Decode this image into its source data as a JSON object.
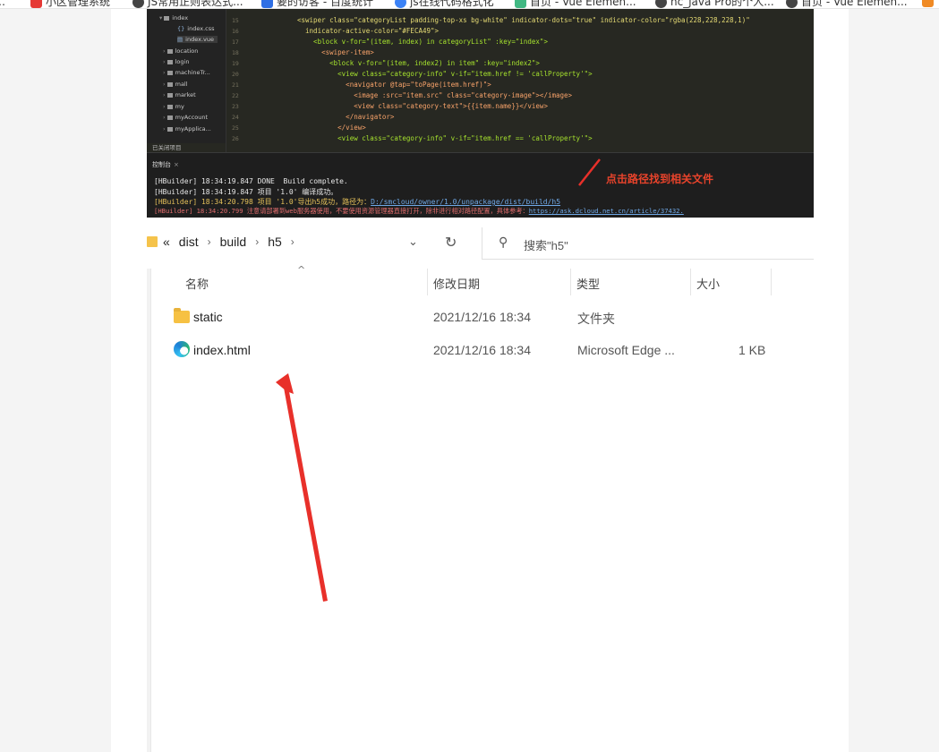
{
  "bookmarks": [
    {
      "label": "…",
      "color": "#555555"
    },
    {
      "label": "小区管理系统",
      "color": "#e53935"
    },
    {
      "label": "JS常用正则表达式...",
      "color": "#444444"
    },
    {
      "label": "要的访客 - 百度统计",
      "color": "#2f6fe4"
    },
    {
      "label": "js在线代码格式化",
      "color": "#3b82f6"
    },
    {
      "label": "首页 - Vue Elemen...",
      "color": "#41b883"
    },
    {
      "label": "nc_java Pro的个人...",
      "color": "#444444"
    },
    {
      "label": "首页 - Vue Elemen...",
      "color": "#444444"
    }
  ],
  "editor": {
    "tree": [
      {
        "label": "index",
        "indent": 1,
        "kind": "open-folder"
      },
      {
        "label": "index.css",
        "indent": 2,
        "kind": "file"
      },
      {
        "label": "index.vue",
        "indent": 2,
        "kind": "file",
        "selected": true
      },
      {
        "label": "location",
        "indent": 1,
        "kind": "folder"
      },
      {
        "label": "login",
        "indent": 1,
        "kind": "folder"
      },
      {
        "label": "machineTr...",
        "indent": 1,
        "kind": "folder"
      },
      {
        "label": "mall",
        "indent": 1,
        "kind": "folder"
      },
      {
        "label": "market",
        "indent": 1,
        "kind": "folder"
      },
      {
        "label": "my",
        "indent": 1,
        "kind": "folder"
      },
      {
        "label": "myAccount",
        "indent": 1,
        "kind": "folder"
      },
      {
        "label": "myApplica...",
        "indent": 1,
        "kind": "folder"
      }
    ],
    "closed_projects": "已关闭项目",
    "line_numbers": [
      "15",
      "16",
      "17",
      "18",
      "19",
      "20",
      "21",
      "22",
      "23",
      "24",
      "25",
      "26"
    ],
    "code_lines": [
      "<swiper class=\"categoryList padding-top-xs bg-white\" indicator-dots=\"true\" indicator-color=\"rgba(228,228,228,1)\"",
      "  indicator-active-color=\"#FECA49\">",
      "    <block v-for=\"(item, index) in categoryList\" :key=\"index\">",
      "      <swiper-item>",
      "        <block v-for=\"(item, index2) in item\" :key=\"index2\">",
      "          <view class=\"category-info\" v-if=\"item.href != 'callProperty'\">",
      "            <navigator @tap=\"toPage(item.href)\">",
      "              <image :src=\"item.src\" class=\"category-image\"></image>",
      "              <view class=\"category-text\">{{item.name}}</view>",
      "            </navigator>",
      "          </view>",
      "          <view class=\"category-info\" v-if=\"item.href == 'callProperty'\">"
    ],
    "console_tab": "控制台",
    "console_lines": [
      {
        "prefix": "[HBuilder] 18:34:19.847",
        "text": " DONE  Build complete.",
        "color": "white"
      },
      {
        "prefix": "[HBuilder] 18:34:19.847",
        "text": " 项目 '1.0' 编译成功。",
        "color": "white"
      },
      {
        "prefix": "[HBuilder] 18:34:20.798",
        "text": " 项目 '1.0'导出h5成功，路径为：",
        "link": "D:/smcloud/owner/1.0/unpackage/dist/build/h5",
        "color": "yellow"
      },
      {
        "prefix": "[HBuilder] 18:34:20.799",
        "text": " 注意请部署到web服务器使用，不要使用资源管理器直接打开，除非进行相对路径配置，具体参考：",
        "link": "https://ask.dcloud.net.cn/article/37432.",
        "color": "red"
      }
    ],
    "annotation": "点击路径找到相关文件"
  },
  "explorer": {
    "breadcrumb": [
      "«",
      "dist",
      "build",
      "h5"
    ],
    "search_placeholder": "搜索\"h5\"",
    "columns": [
      "名称",
      "修改日期",
      "类型",
      "大小"
    ],
    "files": [
      {
        "name": "static",
        "date": "2021/12/16 18:34",
        "type": "文件夹",
        "size": "",
        "icon": "folder-icon"
      },
      {
        "name": "index.html",
        "date": "2021/12/16 18:34",
        "type": "Microsoft Edge ...",
        "size": "1 KB",
        "icon": "edge-icon"
      }
    ]
  },
  "colors": {
    "arrow": "#e8302a",
    "folder": "#f6c143",
    "editor_bg": "#272822"
  }
}
